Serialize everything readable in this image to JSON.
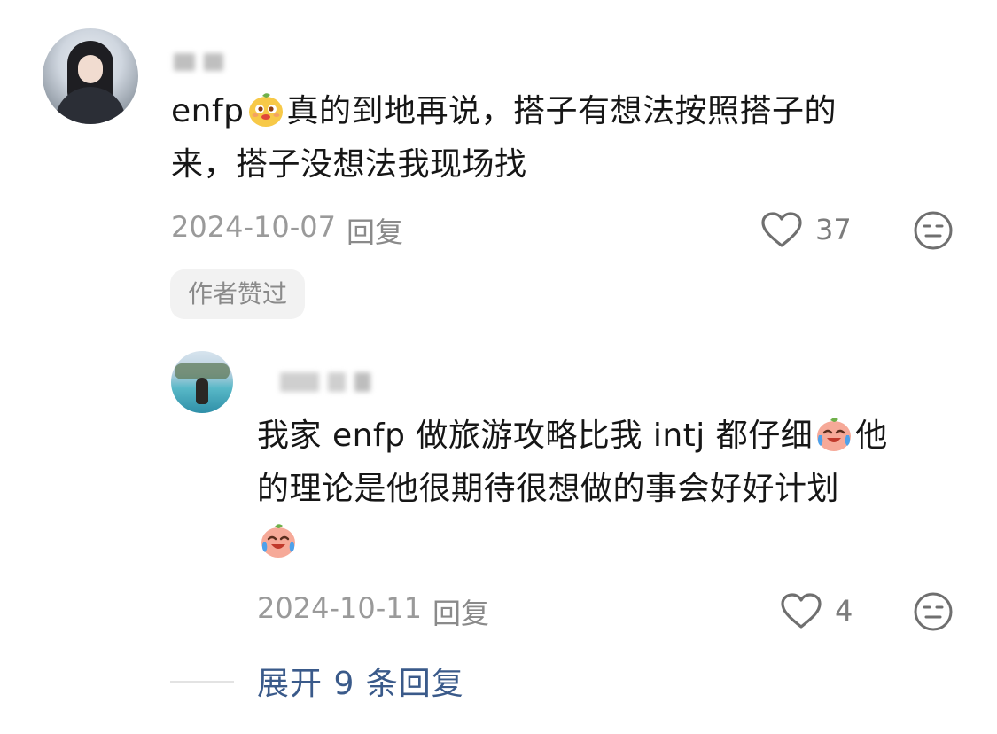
{
  "comment": {
    "text_before_emoji": "enfp",
    "emoji": "smirk-face-emoji",
    "text_line1_rest": "真的到地再说，搭子有想法按照搭子的",
    "text_line2": "来，搭子没想法我现场找",
    "date": "2024-10-07",
    "reply_label": "回复",
    "likes": "37",
    "author_badge": "作者赞过"
  },
  "reply": {
    "text_line1": "我家 enfp 做旅游攻略比我 intj 都仔细",
    "text_line1_tail": "他",
    "text_line2": "的理论是他很期待很想做的事会好好计划",
    "emoji": "crying-laughing-emoji",
    "date": "2024-10-11",
    "reply_label": "回复",
    "likes": "4"
  },
  "expand": {
    "label": "展开 9 条回复"
  },
  "colors": {
    "text_primary": "#161616",
    "text_meta": "#9a9a9a",
    "link": "#3a5a8a",
    "badge_bg": "#f2f2f2"
  }
}
